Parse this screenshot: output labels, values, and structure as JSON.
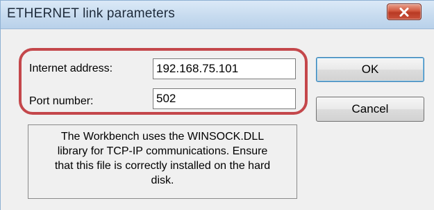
{
  "window": {
    "title": "ETHERNET link parameters",
    "close_icon": "close-icon"
  },
  "form": {
    "ip_label": "Internet address:",
    "ip_value": "192.168.75.101",
    "port_label": "Port number:",
    "port_value": "502"
  },
  "buttons": {
    "ok_label": "OK",
    "cancel_label": "Cancel"
  },
  "info": {
    "lines": [
      "The Workbench uses the WINSOCK.DLL",
      "library for TCP-IP communications. Ensure",
      "that this file is correctly installed on the hard",
      "disk."
    ]
  },
  "colors": {
    "highlight": "#c4474b",
    "title_bar": "#c7dbef",
    "close_button": "#c9503a",
    "dialog_background": "#f0f0f0"
  }
}
